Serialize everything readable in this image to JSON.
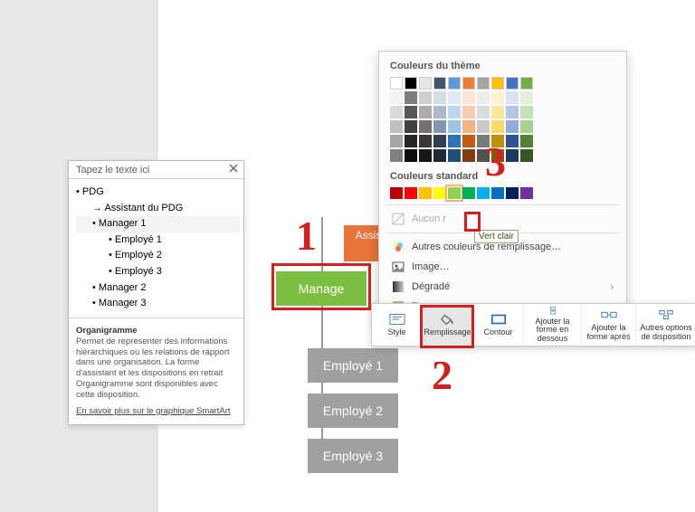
{
  "textpane": {
    "title": "Tapez le texte ici",
    "items": [
      {
        "level": 0,
        "label": "PDG"
      },
      {
        "level": 1,
        "label": "Assistant du PDG",
        "style": "arrow"
      },
      {
        "level": 1,
        "label": "Manager 1",
        "style": "bullet",
        "selected": true
      },
      {
        "level": 2,
        "label": "Employé 1"
      },
      {
        "level": 2,
        "label": "Employé 2"
      },
      {
        "level": 2,
        "label": "Employé 3"
      },
      {
        "level": 1,
        "label": "Manager 2",
        "style": "bullet"
      },
      {
        "level": 1,
        "label": "Manager 3",
        "style": "bullet"
      }
    ],
    "desc_title": "Organigramme",
    "desc_body": "Permet de représenter des informations hiérarchiques ou les relations de rapport dans une organisation. La forme d'assistant et les dispositions en retrait Organigramme sont disponibles avec cette disposition.",
    "desc_link": "En savoir plus sur le graphique SmartArt"
  },
  "org": {
    "assistant": "Assist du l",
    "manager": "Manage",
    "emp1": "Employé 1",
    "emp2": "Employé 2",
    "emp3": "Employé 3"
  },
  "minitb": {
    "style": "Style",
    "fill": "Remplissage",
    "outline": "Contour",
    "add_below": "Ajouter la forme en dessous",
    "add_after": "Ajouter la forme après",
    "layout_opts": "Autres options de disposition"
  },
  "colorpop": {
    "theme_heading": "Couleurs du thème",
    "theme_top": [
      "#FFFFFF",
      "#000000",
      "#E7E6E6",
      "#44546A",
      "#5B9BD5",
      "#ED7D31",
      "#A5A5A5",
      "#FFC000",
      "#4472C4",
      "#70AD47"
    ],
    "theme_tints": [
      [
        "#F2F2F2",
        "#7F7F7F",
        "#D0CECE",
        "#D6DCE5",
        "#DEEBF7",
        "#FBE5D6",
        "#EDEDED",
        "#FFF2CC",
        "#D9E2F3",
        "#E2F0D9"
      ],
      [
        "#D9D9D9",
        "#595959",
        "#AEABAB",
        "#ADB9CA",
        "#BDD7EE",
        "#F8CBAD",
        "#DBDBDB",
        "#FFE699",
        "#B4C7E7",
        "#C5E0B4"
      ],
      [
        "#BFBFBF",
        "#404040",
        "#757171",
        "#8497B0",
        "#9DC3E6",
        "#F4B183",
        "#C9C9C9",
        "#FFD966",
        "#8FAADC",
        "#A9D18E"
      ],
      [
        "#A6A6A6",
        "#262626",
        "#3B3838",
        "#333F50",
        "#2E75B6",
        "#C55A11",
        "#7B7B7B",
        "#BF9000",
        "#2F5597",
        "#548235"
      ],
      [
        "#808080",
        "#0D0D0D",
        "#171717",
        "#222A35",
        "#1F4E79",
        "#843C0C",
        "#525252",
        "#7F6000",
        "#203864",
        "#385723"
      ]
    ],
    "std_heading": "Couleurs standard",
    "std": [
      "#C00000",
      "#FF0000",
      "#FFC000",
      "#FFFF00",
      "#92D050",
      "#00B050",
      "#00B0F0",
      "#0070C0",
      "#002060",
      "#7030A0"
    ],
    "tooltip": "Vert clair",
    "no_fill": "Aucun r",
    "more_fill": "Autres couleurs de remplissage…",
    "image": "Image…",
    "gradient": "Dégradé",
    "texture": "Texture"
  },
  "anno": {
    "n1": "1",
    "n2": "2",
    "n3": "3"
  }
}
